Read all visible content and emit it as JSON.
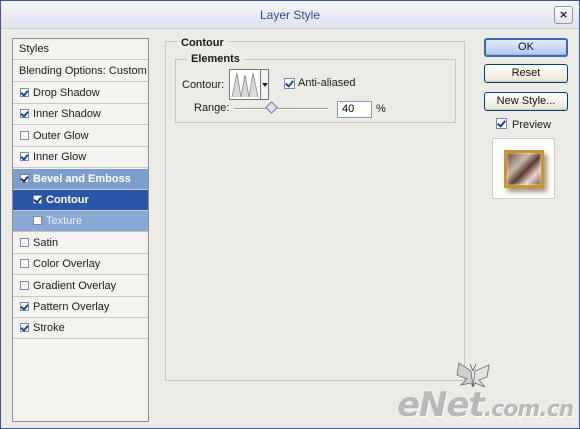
{
  "window": {
    "title": "Layer Style",
    "close_glyph": "×"
  },
  "styles_panel": {
    "header": "Styles",
    "blending_label": "Blending Options: Custom",
    "items": [
      {
        "label": "Drop Shadow",
        "checked": true
      },
      {
        "label": "Inner Shadow",
        "checked": true
      },
      {
        "label": "Outer Glow",
        "checked": false
      },
      {
        "label": "Inner Glow",
        "checked": true
      },
      {
        "label": "Bevel and Emboss",
        "checked": true
      },
      {
        "label": "Contour",
        "checked": true
      },
      {
        "label": "Texture",
        "checked": false
      },
      {
        "label": "Satin",
        "checked": false
      },
      {
        "label": "Color Overlay",
        "checked": false
      },
      {
        "label": "Gradient Overlay",
        "checked": false
      },
      {
        "label": "Pattern Overlay",
        "checked": true
      },
      {
        "label": "Stroke",
        "checked": true
      }
    ]
  },
  "contour_panel": {
    "group_title": "Contour",
    "sub_title": "Elements",
    "contour_label": "Contour:",
    "anti_aliased_label": "Anti-aliased",
    "anti_aliased": true,
    "range_label": "Range:",
    "range_value": "40",
    "range_unit": "%",
    "range_fraction": 0.4
  },
  "buttons": {
    "ok": "OK",
    "reset": "Reset",
    "new_style": "New Style...",
    "preview_label": "Preview",
    "preview_checked": true
  },
  "watermark": {
    "main": "eNet",
    "suffix": ".com.cn"
  },
  "colors": {
    "selection": "#2b56a6",
    "selection_parent": "#7c9ecf",
    "title_text": "#2e4d8b",
    "accent_border": "#3c66b8"
  }
}
